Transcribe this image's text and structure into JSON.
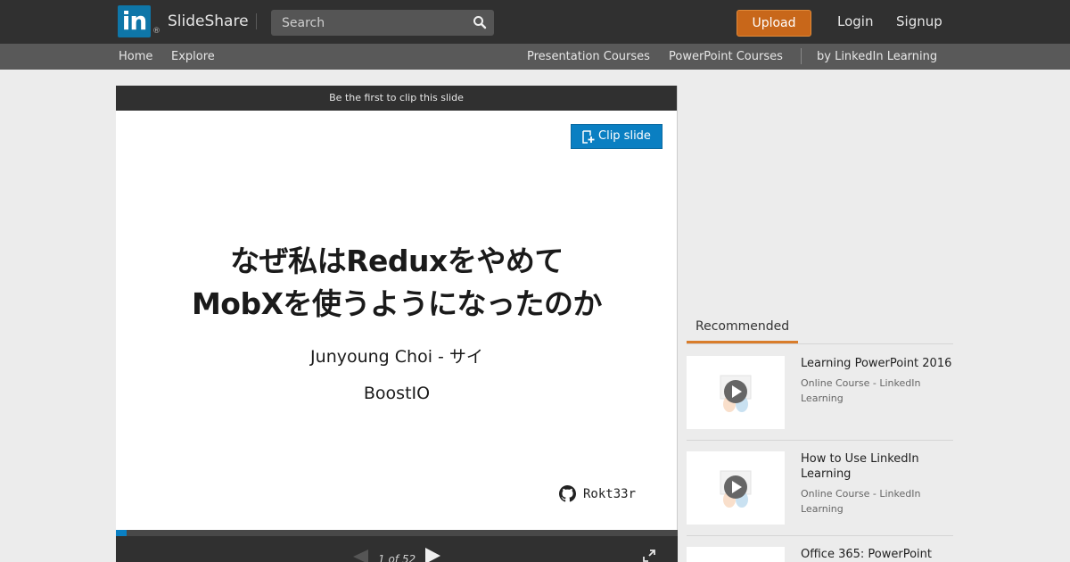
{
  "header": {
    "logo_mark": "in",
    "logo_registered": "®",
    "brand": "SlideShare",
    "search_placeholder": "Search",
    "upload_label": "Upload",
    "login_label": "Login",
    "signup_label": "Signup"
  },
  "subnav": {
    "home": "Home",
    "explore": "Explore",
    "presentation_courses": "Presentation Courses",
    "powerpoint_courses": "PowerPoint Courses",
    "linkedin_learning": "by LinkedIn Learning"
  },
  "player": {
    "clip_header": "Be the first to clip this slide",
    "clip_button": "Clip slide",
    "slide": {
      "title_line1": "なぜ私はReduxをやめて",
      "title_line2": "MobXを使うようになったのか",
      "author": "Junyoung Choi - サイ",
      "org": "BoostIO",
      "github": "Rokt33r"
    },
    "page_indicator": "1 of 52",
    "progress_fraction": 0.019
  },
  "recommended": {
    "tab_label": "Recommended",
    "items": [
      {
        "title": "Learning PowerPoint 2016",
        "meta": "Online Course - LinkedIn Learning"
      },
      {
        "title": "How to Use LinkedIn Learning",
        "meta": "Online Course - LinkedIn Learning"
      },
      {
        "title": "Office 365: PowerPoint",
        "meta": ""
      }
    ]
  },
  "colors": {
    "topbar": "#303030",
    "subnav": "#595959",
    "upload": "#c8671a",
    "accent_blue": "#0a7fc2",
    "rec_underline": "#d97d2b"
  }
}
